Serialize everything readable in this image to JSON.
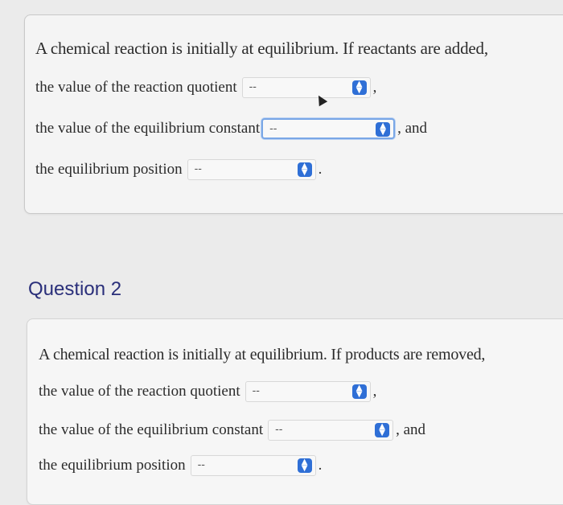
{
  "question1": {
    "prompt": "A chemical reaction is initially at equilibrium. If reactants are added,",
    "rows": [
      {
        "label": "the value of the reaction quotient",
        "selected": "--",
        "suffix": ","
      },
      {
        "label": "the value of the equilibrium constant",
        "selected": "--",
        "suffix": ", and"
      },
      {
        "label": "the equilibrium position",
        "selected": "--",
        "suffix": "."
      }
    ]
  },
  "question2": {
    "title": "Question 2",
    "prompt": "A chemical reaction is initially at equilibrium. If products are removed,",
    "rows": [
      {
        "label": "the value of the reaction quotient",
        "selected": "--",
        "suffix": ","
      },
      {
        "label": "the value of the equilibrium constant",
        "selected": "--",
        "suffix": ", and"
      },
      {
        "label": "the equilibrium position",
        "selected": "--",
        "suffix": "."
      }
    ]
  },
  "colors": {
    "accent": "#2f6fd6",
    "focus_ring": "#7aa7e6",
    "question_title": "#2a2f7a"
  }
}
